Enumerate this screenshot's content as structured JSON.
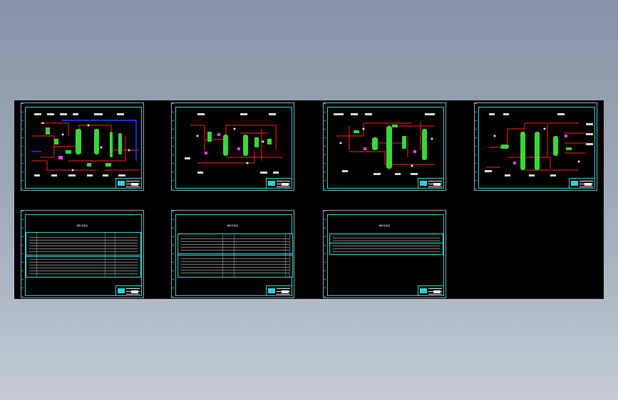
{
  "drawing": {
    "model_space_color": "#000000",
    "frame_color": "#2ed0d0",
    "pipe_color": "#ff2020",
    "vessel_color": "#39d639",
    "utility_line_color": "#2040ff",
    "instrument_color": "#e0e0ff",
    "sheets": [
      {
        "id": "pfd-1",
        "kind": "process-flow-diagram"
      },
      {
        "id": "pfd-2",
        "kind": "process-flow-diagram"
      },
      {
        "id": "pfd-3",
        "kind": "process-flow-diagram"
      },
      {
        "id": "pfd-4",
        "kind": "process-flow-diagram"
      },
      {
        "id": "table-1",
        "kind": "material-balance-table",
        "title": "物料平衡表"
      },
      {
        "id": "table-2",
        "kind": "material-balance-table",
        "title": "物料平衡表"
      },
      {
        "id": "table-3",
        "kind": "material-balance-table",
        "title": "物料平衡表"
      }
    ]
  }
}
